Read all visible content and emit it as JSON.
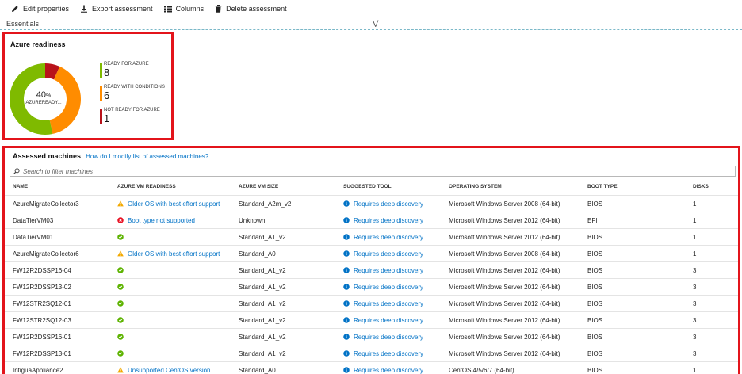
{
  "toolbar": {
    "edit_properties": "Edit properties",
    "export_assessment": "Export assessment",
    "columns": "Columns",
    "delete_assessment": "Delete assessment"
  },
  "essentials": {
    "label": "Essentials"
  },
  "readiness": {
    "title": "Azure readiness",
    "center_percent": "40",
    "center_percent_unit": "%",
    "center_label": "AZUREREADY...",
    "legend": [
      {
        "label": "READY FOR AZURE",
        "count": "8",
        "color": "#7fba00"
      },
      {
        "label": "READY WITH CONDITIONS",
        "count": "6",
        "color": "#ff8c00"
      },
      {
        "label": "NOT READY FOR AZURE",
        "count": "1",
        "color": "#b8121a"
      }
    ]
  },
  "assessed": {
    "title": "Assessed machines",
    "help_link": "How do I modify list of assessed machines?",
    "search_placeholder": "Search to filter machines",
    "columns": [
      "NAME",
      "AZURE VM READINESS",
      "AZURE VM SIZE",
      "SUGGESTED TOOL",
      "OPERATING SYSTEM",
      "BOOT TYPE",
      "DISKS"
    ],
    "rows": [
      {
        "name": "AzureMigrateCollector3",
        "readiness": "Older OS with best effort support",
        "readiness_icon": "warning-icon",
        "size": "Standard_A2m_v2",
        "tool": "Requires deep discovery",
        "os": "Microsoft Windows Server 2008 (64-bit)",
        "boot": "BIOS",
        "disks": "1"
      },
      {
        "name": "DataTierVM03",
        "readiness": "Boot type not supported",
        "readiness_icon": "error-icon",
        "size": "Unknown",
        "tool": "Requires deep discovery",
        "os": "Microsoft Windows Server 2012 (64-bit)",
        "boot": "EFI",
        "disks": "1"
      },
      {
        "name": "DataTierVM01",
        "readiness": "",
        "readiness_icon": "check-icon",
        "size": "Standard_A1_v2",
        "tool": "Requires deep discovery",
        "os": "Microsoft Windows Server 2012 (64-bit)",
        "boot": "BIOS",
        "disks": "1"
      },
      {
        "name": "AzureMigrateCollector6",
        "readiness": "Older OS with best effort support",
        "readiness_icon": "warning-icon",
        "size": "Standard_A0",
        "tool": "Requires deep discovery",
        "os": "Microsoft Windows Server 2008 (64-bit)",
        "boot": "BIOS",
        "disks": "1"
      },
      {
        "name": "FW12R2DSSP16-04",
        "readiness": "",
        "readiness_icon": "check-icon",
        "size": "Standard_A1_v2",
        "tool": "Requires deep discovery",
        "os": "Microsoft Windows Server 2012 (64-bit)",
        "boot": "BIOS",
        "disks": "3"
      },
      {
        "name": "FW12R2DSSP13-02",
        "readiness": "",
        "readiness_icon": "check-icon",
        "size": "Standard_A1_v2",
        "tool": "Requires deep discovery",
        "os": "Microsoft Windows Server 2012 (64-bit)",
        "boot": "BIOS",
        "disks": "3"
      },
      {
        "name": "FW12STR2SQ12-01",
        "readiness": "",
        "readiness_icon": "check-icon",
        "size": "Standard_A1_v2",
        "tool": "Requires deep discovery",
        "os": "Microsoft Windows Server 2012 (64-bit)",
        "boot": "BIOS",
        "disks": "3"
      },
      {
        "name": "FW12STR2SQ12-03",
        "readiness": "",
        "readiness_icon": "check-icon",
        "size": "Standard_A1_v2",
        "tool": "Requires deep discovery",
        "os": "Microsoft Windows Server 2012 (64-bit)",
        "boot": "BIOS",
        "disks": "3"
      },
      {
        "name": "FW12R2DSSP16-01",
        "readiness": "",
        "readiness_icon": "check-icon",
        "size": "Standard_A1_v2",
        "tool": "Requires deep discovery",
        "os": "Microsoft Windows Server 2012 (64-bit)",
        "boot": "BIOS",
        "disks": "3"
      },
      {
        "name": "FW12R2DSSP13-01",
        "readiness": "",
        "readiness_icon": "check-icon",
        "size": "Standard_A1_v2",
        "tool": "Requires deep discovery",
        "os": "Microsoft Windows Server 2012 (64-bit)",
        "boot": "BIOS",
        "disks": "3"
      },
      {
        "name": "IntiguaAppliance2",
        "readiness": "Unsupported CentOS version",
        "readiness_icon": "warning-icon",
        "size": "Standard_A0",
        "tool": "Requires deep discovery",
        "os": "CentOS 4/5/6/7 (64-bit)",
        "boot": "BIOS",
        "disks": "1"
      }
    ]
  }
}
